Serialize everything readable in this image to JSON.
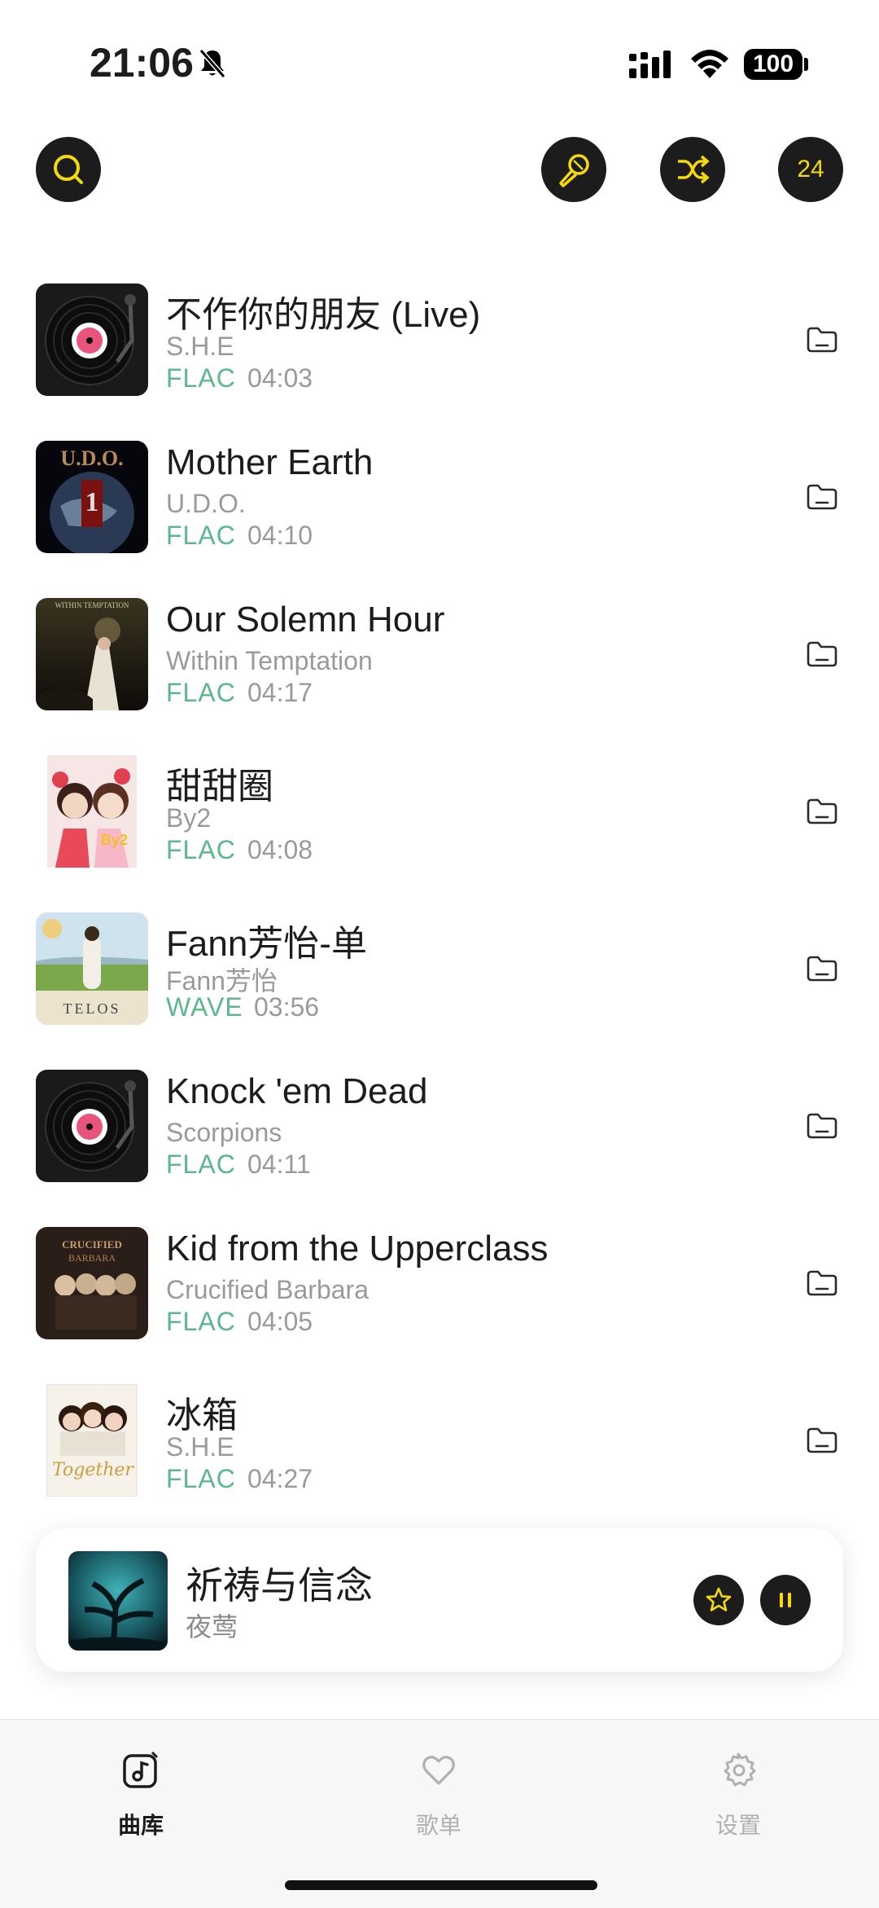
{
  "status_bar": {
    "time": "21:06",
    "battery": "100"
  },
  "toolbar": {
    "queue_count": "24"
  },
  "songs": [
    {
      "title": "不作你的朋友 (Live)",
      "artist": "S.H.E",
      "format": "FLAC",
      "duration": "04:03",
      "art": "vinyl"
    },
    {
      "title": "Mother Earth",
      "artist": "U.D.O.",
      "format": "FLAC",
      "duration": "04:10",
      "art": "udo"
    },
    {
      "title": "Our Solemn Hour",
      "artist": "Within Temptation",
      "format": "FLAC",
      "duration": "04:17",
      "art": "within"
    },
    {
      "title": "甜甜圈",
      "artist": "By2",
      "format": "FLAC",
      "duration": "04:08",
      "art": "by2"
    },
    {
      "title": "Fann芳怡-单",
      "artist": "Fann芳怡",
      "format": "WAVE",
      "duration": "03:56",
      "art": "fann"
    },
    {
      "title": "Knock 'em Dead",
      "artist": "Scorpions",
      "format": "FLAC",
      "duration": "04:11",
      "art": "vinyl"
    },
    {
      "title": "Kid from the Upperclass",
      "artist": "Crucified Barbara",
      "format": "FLAC",
      "duration": "04:05",
      "art": "barbara"
    },
    {
      "title": "冰箱",
      "artist": "S.H.E",
      "format": "FLAC",
      "duration": "04:27",
      "art": "together"
    }
  ],
  "now_playing": {
    "title": "祈祷与信念",
    "artist": "夜莺"
  },
  "tabs": [
    {
      "label": "曲库",
      "icon": "music-library-icon",
      "active": true
    },
    {
      "label": "歌单",
      "icon": "heart-icon",
      "active": false
    },
    {
      "label": "设置",
      "icon": "gear-icon",
      "active": false
    }
  ],
  "colors": {
    "accent": "#f5d90a",
    "format_green": "#5cb88a",
    "dark": "#1c1c1c"
  }
}
